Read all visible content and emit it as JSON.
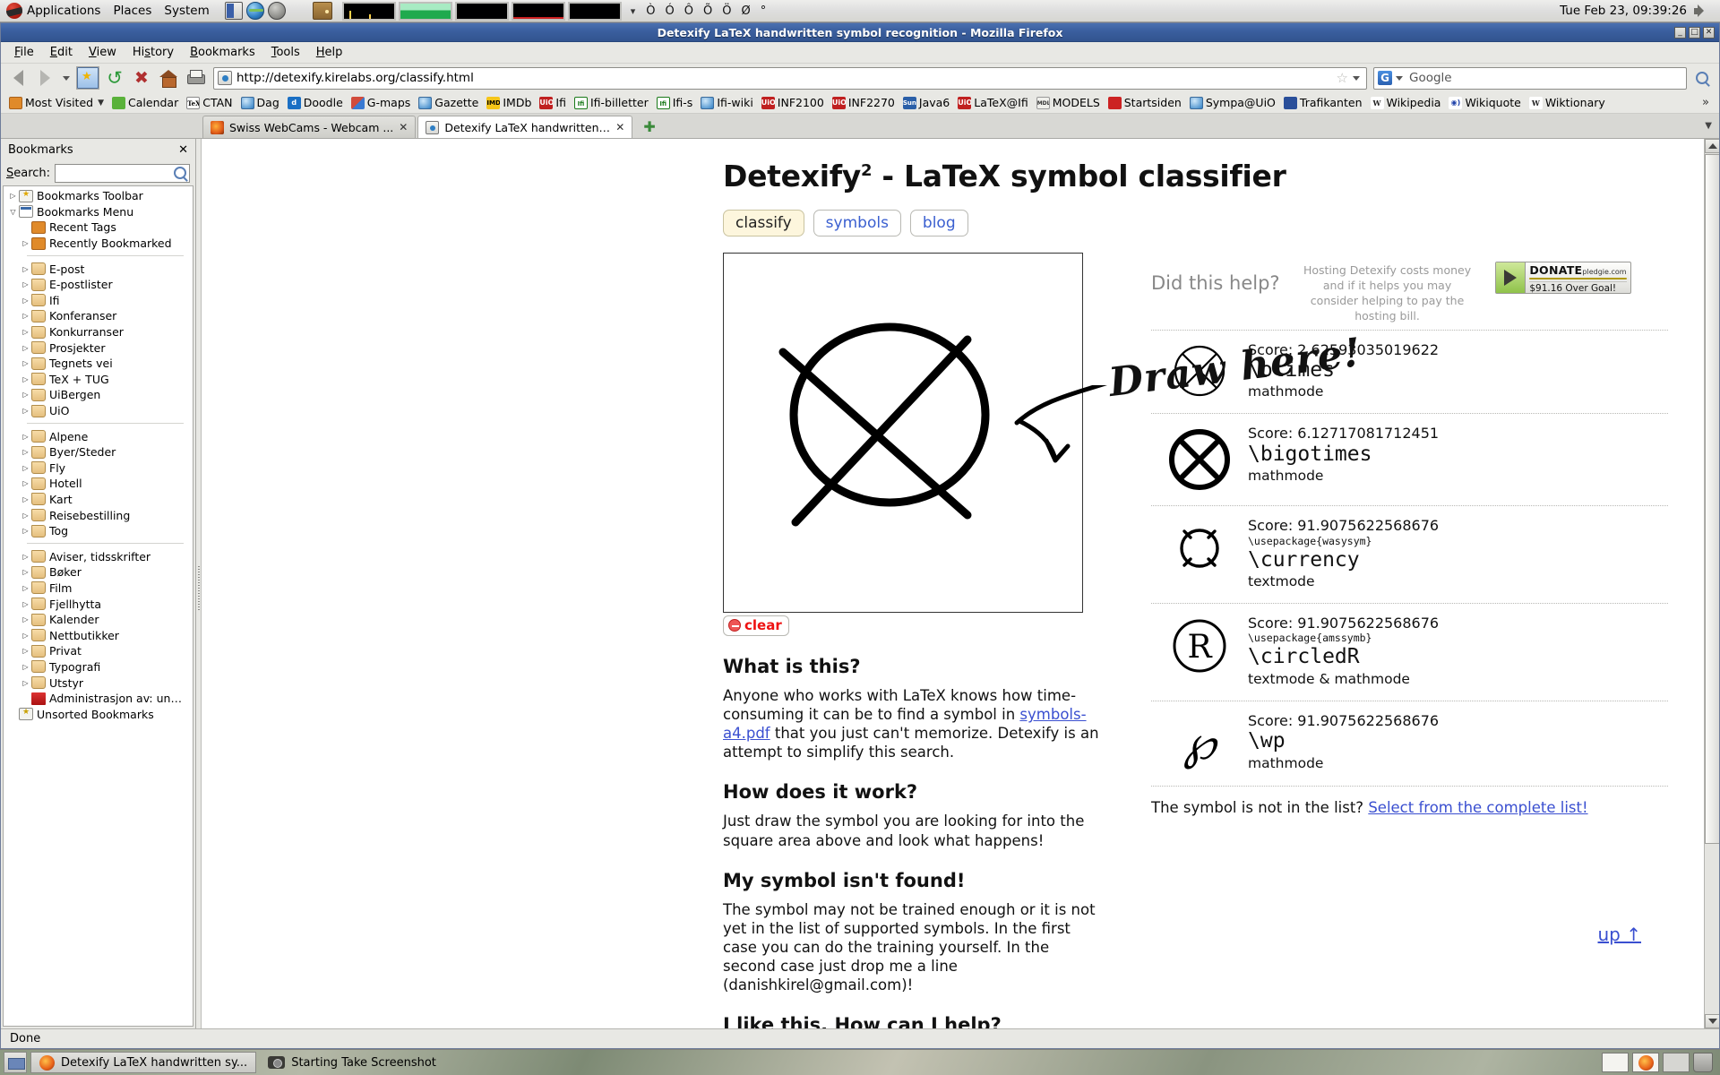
{
  "gnome_panel": {
    "menus": [
      "Applications",
      "Places",
      "System"
    ],
    "launchers": [
      "terminal-launcher",
      "browser-launcher",
      "gnu-launcher",
      "drawer-launcher"
    ],
    "monitors": [
      "cpu-monitor",
      "memory-monitor",
      "network-monitor",
      "disk-monitor",
      "load-monitor"
    ],
    "accents": [
      "Ò",
      "Ó",
      "Ô",
      "Õ",
      "Ö",
      "Ø",
      "°"
    ],
    "clock": "Tue Feb 23, 09:39:26"
  },
  "window": {
    "title": "Detexify LaTeX handwritten symbol recognition - Mozilla Firefox",
    "buttons": [
      "_",
      "□",
      "✕"
    ]
  },
  "menubar": [
    "File",
    "Edit",
    "View",
    "History",
    "Bookmarks",
    "Tools",
    "Help"
  ],
  "navbar": {
    "url": "http://detexify.kirelabs.org/classify.html",
    "search_value": "Google",
    "back_label": "Back",
    "forward_label": "Forward",
    "bookmark_label": "Bookmarks",
    "reload_label": "Reload",
    "stop_label": "Stop",
    "home_label": "Home",
    "print_label": "Print"
  },
  "bookmarks_toolbar": {
    "items": [
      {
        "label": "Most Visited",
        "icon": "orange",
        "caret": true
      },
      {
        "label": "Calendar",
        "icon": "star"
      },
      {
        "label": "CTAN",
        "icon": "tex"
      },
      {
        "label": "Dag",
        "icon": "globe"
      },
      {
        "label": "Doodle",
        "icon": "blue-d"
      },
      {
        "label": "G-maps",
        "icon": "gmap"
      },
      {
        "label": "Gazette",
        "icon": "globe"
      },
      {
        "label": "IMDb",
        "icon": "imdb"
      },
      {
        "label": "Ifi",
        "icon": "uio"
      },
      {
        "label": "Ifi-billetter",
        "icon": "ifi"
      },
      {
        "label": "Ifi-s",
        "icon": "ifi"
      },
      {
        "label": "Ifi-wiki",
        "icon": "globe"
      },
      {
        "label": "INF2100",
        "icon": "uio"
      },
      {
        "label": "INF2270",
        "icon": "uio"
      },
      {
        "label": "Java6",
        "icon": "sun"
      },
      {
        "label": "LaTeX@Ifi",
        "icon": "uio"
      },
      {
        "label": "MODELS",
        "icon": "models"
      },
      {
        "label": "Startsiden",
        "icon": "start"
      },
      {
        "label": "Sympa@UiO",
        "icon": "globe"
      },
      {
        "label": "Trafikanten",
        "icon": "traf"
      },
      {
        "label": "Wikipedia",
        "icon": "wiki"
      },
      {
        "label": "Wikiquote",
        "icon": "wq"
      },
      {
        "label": "Wiktionary",
        "icon": "wiki"
      }
    ],
    "overflow": "»"
  },
  "tabs": [
    {
      "label": "Swiss WebCams - Webcam ...",
      "icon": "firefox",
      "active": false
    },
    {
      "label": "Detexify LaTeX handwritten ...",
      "icon": "detexify",
      "active": true
    }
  ],
  "new_tab_label": "+",
  "sidebar": {
    "title": "Bookmarks",
    "close": "✕",
    "search_label": "Search:",
    "search_value": "",
    "tree": [
      {
        "label": "Bookmarks Toolbar",
        "icon": "toolbar",
        "twisty": "closed",
        "indent": 0
      },
      {
        "label": "Bookmarks Menu",
        "icon": "menu",
        "twisty": "open",
        "indent": 0
      },
      {
        "label": "Recent Tags",
        "icon": "tag",
        "twisty": "none",
        "indent": 1
      },
      {
        "label": "Recently Bookmarked",
        "icon": "tag",
        "twisty": "closed",
        "indent": 1
      },
      {
        "separator": true
      },
      {
        "label": "E-post",
        "icon": "folder",
        "twisty": "closed",
        "indent": 1
      },
      {
        "label": "E-postlister",
        "icon": "folder",
        "twisty": "closed",
        "indent": 1
      },
      {
        "label": "Ifi",
        "icon": "folder",
        "twisty": "closed",
        "indent": 1
      },
      {
        "label": "Konferanser",
        "icon": "folder",
        "twisty": "closed",
        "indent": 1
      },
      {
        "label": "Konkurranser",
        "icon": "folder",
        "twisty": "closed",
        "indent": 1
      },
      {
        "label": "Prosjekter",
        "icon": "folder",
        "twisty": "closed",
        "indent": 1
      },
      {
        "label": "Tegnets vei",
        "icon": "folder",
        "twisty": "closed",
        "indent": 1
      },
      {
        "label": "TeX + TUG",
        "icon": "folder",
        "twisty": "closed",
        "indent": 1
      },
      {
        "label": "UiBergen",
        "icon": "folder",
        "twisty": "closed",
        "indent": 1
      },
      {
        "label": "UiO",
        "icon": "folder",
        "twisty": "closed",
        "indent": 1
      },
      {
        "separator": true
      },
      {
        "label": "Alpene",
        "icon": "folder",
        "twisty": "closed",
        "indent": 1
      },
      {
        "label": "Byer/Steder",
        "icon": "folder",
        "twisty": "closed",
        "indent": 1
      },
      {
        "label": "Fly",
        "icon": "folder",
        "twisty": "closed",
        "indent": 1
      },
      {
        "label": "Hotell",
        "icon": "folder",
        "twisty": "closed",
        "indent": 1
      },
      {
        "label": "Kart",
        "icon": "folder",
        "twisty": "closed",
        "indent": 1
      },
      {
        "label": "Reisebestilling",
        "icon": "folder",
        "twisty": "closed",
        "indent": 1
      },
      {
        "label": "Tog",
        "icon": "folder",
        "twisty": "closed",
        "indent": 1
      },
      {
        "separator": true
      },
      {
        "label": "Aviser, tidsskrifter",
        "icon": "folder",
        "twisty": "closed",
        "indent": 1
      },
      {
        "label": "Bøker",
        "icon": "folder",
        "twisty": "closed",
        "indent": 1
      },
      {
        "label": "Film",
        "icon": "folder",
        "twisty": "closed",
        "indent": 1
      },
      {
        "label": "Fjellhytta",
        "icon": "folder",
        "twisty": "closed",
        "indent": 1
      },
      {
        "label": "Kalender",
        "icon": "folder",
        "twisty": "closed",
        "indent": 1
      },
      {
        "label": "Nettbutikker",
        "icon": "folder",
        "twisty": "closed",
        "indent": 1
      },
      {
        "label": "Privat",
        "icon": "folder",
        "twisty": "closed",
        "indent": 1
      },
      {
        "label": "Typografi",
        "icon": "folder",
        "twisty": "closed",
        "indent": 1
      },
      {
        "label": "Utstyr",
        "icon": "folder",
        "twisty": "closed",
        "indent": 1
      },
      {
        "label": "Administrasjon av: un…",
        "icon": "fav-red",
        "twisty": "none",
        "indent": 1
      },
      {
        "label": "Unsorted Bookmarks",
        "icon": "unsorted",
        "twisty": "none",
        "indent": 0
      }
    ]
  },
  "page": {
    "title_main": "Detexify",
    "title_sup": "2",
    "title_rest": " - LaTeX symbol classifier",
    "nav_tabs": [
      {
        "label": "classify",
        "selected": true
      },
      {
        "label": "symbols",
        "selected": false
      },
      {
        "label": "blog",
        "selected": false
      }
    ],
    "draw_here": "Draw here!",
    "clear_label": "clear",
    "sections": [
      {
        "heading": "What is this?",
        "body_pre": "Anyone who works with LaTeX knows how time-consuming it can be to find a symbol in ",
        "link": "symbols-a4.pdf",
        "body_post": " that you just can't memorize. Detexify is an attempt to simplify this search."
      },
      {
        "heading": "How does it work?",
        "body_pre": "Just draw the symbol you are looking for into the square area above and look what happens!",
        "link": "",
        "body_post": ""
      },
      {
        "heading": "My symbol isn't found!",
        "body_pre": "The symbol may not be trained enough or it is not yet in the list of supported symbols. In the first case you can do the training yourself. In the second case just drop me a line (danishkirel@gmail.com)!",
        "link": "",
        "body_post": ""
      },
      {
        "heading": "I like this. How can I help?",
        "body_pre": "",
        "link": "",
        "body_post": ""
      }
    ],
    "did_this_help": "Did this help?",
    "hosting_msg": "Hosting Detexify costs money and if it helps you may consider helping to pay the hosting bill.",
    "pledgie": {
      "donate": "DONATE",
      "brand": "pledgie.com",
      "goal": "$91.16 Over Goal!"
    },
    "results": [
      {
        "symbol": "otimes",
        "score": "Score: 2.62593035019622",
        "package": "",
        "command": "\\otimes",
        "mode": "mathmode"
      },
      {
        "symbol": "bigotimes",
        "score": "Score: 6.12717081712451",
        "package": "",
        "command": "\\bigotimes",
        "mode": "mathmode"
      },
      {
        "symbol": "currency",
        "score": "Score: 91.9075622568676",
        "package": "\\usepackage{wasysym}",
        "command": "\\currency",
        "mode": "textmode"
      },
      {
        "symbol": "circledR",
        "score": "Score: 91.9075622568676",
        "package": "\\usepackage{amssymb}",
        "command": "\\circledR",
        "mode": "textmode & mathmode"
      },
      {
        "symbol": "wp",
        "score": "Score: 91.9075622568676",
        "package": "",
        "command": "\\wp",
        "mode": "mathmode"
      }
    ],
    "not_in_list_text": "The symbol is not in the list? ",
    "not_in_list_link": "Select from the complete list!",
    "up_link": "up ↑"
  },
  "statusbar": {
    "text": "Done"
  },
  "taskbar": {
    "windows": [
      {
        "label": "Detexify LaTeX handwritten sy...",
        "icon": "firefox",
        "active": true
      },
      {
        "label": "Starting Take Screenshot",
        "icon": "camera",
        "active": false
      }
    ],
    "workspaces": [
      "ws-1",
      "ws-2",
      "ws-3"
    ]
  },
  "colors": {
    "titlebar": "#3a5e9e",
    "link": "#3a4fd0",
    "tab_selected_bg": "#fdf6dd",
    "clear_red": "#ee1111",
    "panel_bg": "#e8e8e4"
  }
}
